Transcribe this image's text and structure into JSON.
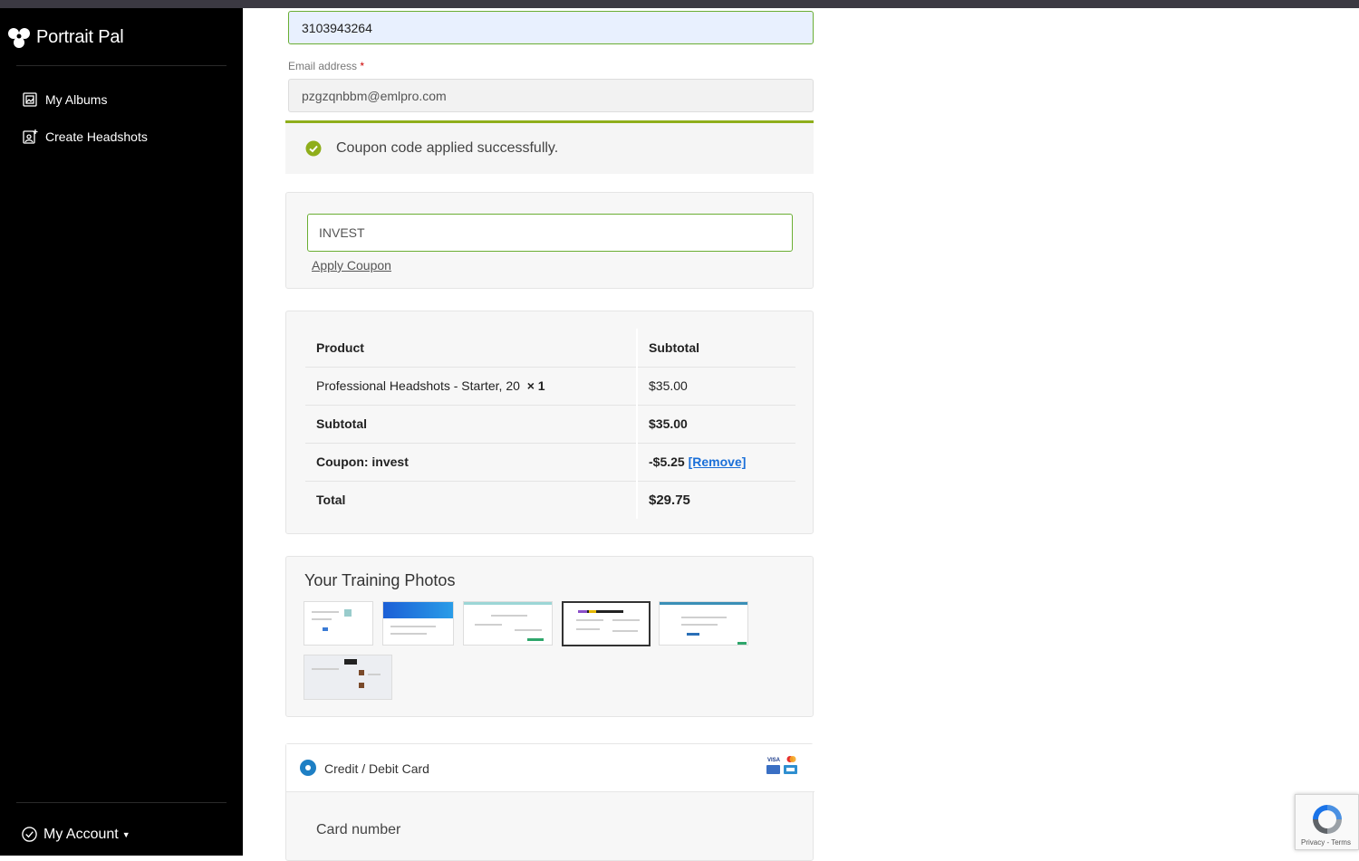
{
  "sidebar": {
    "brand": "Portrait Pal",
    "items": [
      {
        "label": "My Albums",
        "icon": "album-icon"
      },
      {
        "label": "Create Headshots",
        "icon": "add-photo-icon"
      }
    ],
    "account_label": "My Account"
  },
  "form": {
    "phone_value": "3103943264",
    "email_label": "Email address",
    "email_required_mark": "*",
    "email_value": "pzgzqnbbm@emlpro.com"
  },
  "notice": {
    "message": "Coupon code applied successfully."
  },
  "coupon": {
    "value": "INVEST",
    "apply_label": "Apply Coupon"
  },
  "order": {
    "headers": [
      "Product",
      "Subtotal"
    ],
    "product_name": "Professional Headshots - Starter, 20",
    "product_qty": "× 1",
    "product_price": "$35.00",
    "subtotal_label": "Subtotal",
    "subtotal_value": "$35.00",
    "coupon_label": "Coupon: invest",
    "coupon_value": "-$5.25",
    "remove_label": "[Remove]",
    "total_label": "Total",
    "total_value": "$29.75"
  },
  "training": {
    "title": "Your Training Photos",
    "photo_count": 6
  },
  "payment": {
    "method_label": "Credit / Debit Card",
    "card_number_label": "Card number"
  },
  "recaptcha": {
    "text": "Privacy - Terms"
  },
  "colors": {
    "sidebar_bg": "#000000",
    "accent_green": "#6aae33",
    "notice_border": "#8fae1b",
    "link_blue": "#1a6fd8",
    "radio_blue": "#1e7fc4"
  }
}
